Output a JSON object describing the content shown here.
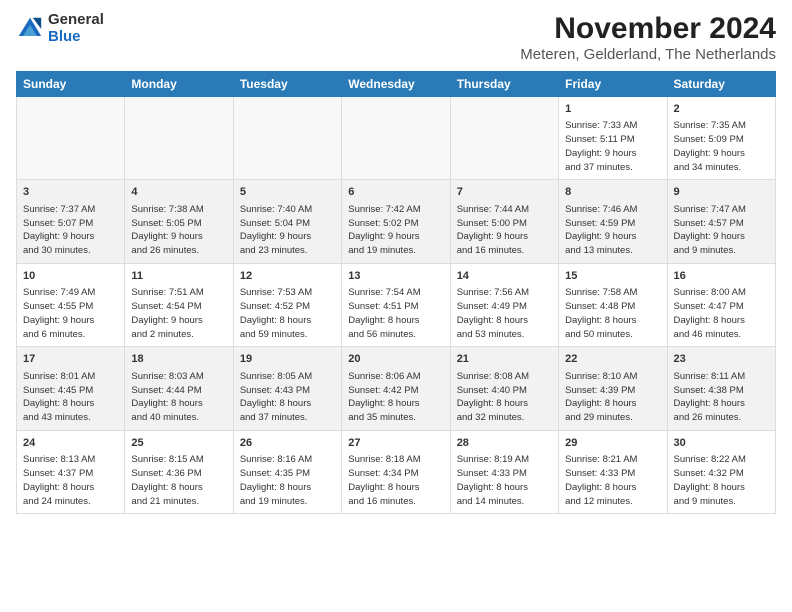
{
  "logo": {
    "general": "General",
    "blue": "Blue"
  },
  "title": "November 2024",
  "subtitle": "Meteren, Gelderland, The Netherlands",
  "weekdays": [
    "Sunday",
    "Monday",
    "Tuesday",
    "Wednesday",
    "Thursday",
    "Friday",
    "Saturday"
  ],
  "weeks": [
    [
      {
        "day": "",
        "info": ""
      },
      {
        "day": "",
        "info": ""
      },
      {
        "day": "",
        "info": ""
      },
      {
        "day": "",
        "info": ""
      },
      {
        "day": "",
        "info": ""
      },
      {
        "day": "1",
        "info": "Sunrise: 7:33 AM\nSunset: 5:11 PM\nDaylight: 9 hours\nand 37 minutes."
      },
      {
        "day": "2",
        "info": "Sunrise: 7:35 AM\nSunset: 5:09 PM\nDaylight: 9 hours\nand 34 minutes."
      }
    ],
    [
      {
        "day": "3",
        "info": "Sunrise: 7:37 AM\nSunset: 5:07 PM\nDaylight: 9 hours\nand 30 minutes."
      },
      {
        "day": "4",
        "info": "Sunrise: 7:38 AM\nSunset: 5:05 PM\nDaylight: 9 hours\nand 26 minutes."
      },
      {
        "day": "5",
        "info": "Sunrise: 7:40 AM\nSunset: 5:04 PM\nDaylight: 9 hours\nand 23 minutes."
      },
      {
        "day": "6",
        "info": "Sunrise: 7:42 AM\nSunset: 5:02 PM\nDaylight: 9 hours\nand 19 minutes."
      },
      {
        "day": "7",
        "info": "Sunrise: 7:44 AM\nSunset: 5:00 PM\nDaylight: 9 hours\nand 16 minutes."
      },
      {
        "day": "8",
        "info": "Sunrise: 7:46 AM\nSunset: 4:59 PM\nDaylight: 9 hours\nand 13 minutes."
      },
      {
        "day": "9",
        "info": "Sunrise: 7:47 AM\nSunset: 4:57 PM\nDaylight: 9 hours\nand 9 minutes."
      }
    ],
    [
      {
        "day": "10",
        "info": "Sunrise: 7:49 AM\nSunset: 4:55 PM\nDaylight: 9 hours\nand 6 minutes."
      },
      {
        "day": "11",
        "info": "Sunrise: 7:51 AM\nSunset: 4:54 PM\nDaylight: 9 hours\nand 2 minutes."
      },
      {
        "day": "12",
        "info": "Sunrise: 7:53 AM\nSunset: 4:52 PM\nDaylight: 8 hours\nand 59 minutes."
      },
      {
        "day": "13",
        "info": "Sunrise: 7:54 AM\nSunset: 4:51 PM\nDaylight: 8 hours\nand 56 minutes."
      },
      {
        "day": "14",
        "info": "Sunrise: 7:56 AM\nSunset: 4:49 PM\nDaylight: 8 hours\nand 53 minutes."
      },
      {
        "day": "15",
        "info": "Sunrise: 7:58 AM\nSunset: 4:48 PM\nDaylight: 8 hours\nand 50 minutes."
      },
      {
        "day": "16",
        "info": "Sunrise: 8:00 AM\nSunset: 4:47 PM\nDaylight: 8 hours\nand 46 minutes."
      }
    ],
    [
      {
        "day": "17",
        "info": "Sunrise: 8:01 AM\nSunset: 4:45 PM\nDaylight: 8 hours\nand 43 minutes."
      },
      {
        "day": "18",
        "info": "Sunrise: 8:03 AM\nSunset: 4:44 PM\nDaylight: 8 hours\nand 40 minutes."
      },
      {
        "day": "19",
        "info": "Sunrise: 8:05 AM\nSunset: 4:43 PM\nDaylight: 8 hours\nand 37 minutes."
      },
      {
        "day": "20",
        "info": "Sunrise: 8:06 AM\nSunset: 4:42 PM\nDaylight: 8 hours\nand 35 minutes."
      },
      {
        "day": "21",
        "info": "Sunrise: 8:08 AM\nSunset: 4:40 PM\nDaylight: 8 hours\nand 32 minutes."
      },
      {
        "day": "22",
        "info": "Sunrise: 8:10 AM\nSunset: 4:39 PM\nDaylight: 8 hours\nand 29 minutes."
      },
      {
        "day": "23",
        "info": "Sunrise: 8:11 AM\nSunset: 4:38 PM\nDaylight: 8 hours\nand 26 minutes."
      }
    ],
    [
      {
        "day": "24",
        "info": "Sunrise: 8:13 AM\nSunset: 4:37 PM\nDaylight: 8 hours\nand 24 minutes."
      },
      {
        "day": "25",
        "info": "Sunrise: 8:15 AM\nSunset: 4:36 PM\nDaylight: 8 hours\nand 21 minutes."
      },
      {
        "day": "26",
        "info": "Sunrise: 8:16 AM\nSunset: 4:35 PM\nDaylight: 8 hours\nand 19 minutes."
      },
      {
        "day": "27",
        "info": "Sunrise: 8:18 AM\nSunset: 4:34 PM\nDaylight: 8 hours\nand 16 minutes."
      },
      {
        "day": "28",
        "info": "Sunrise: 8:19 AM\nSunset: 4:33 PM\nDaylight: 8 hours\nand 14 minutes."
      },
      {
        "day": "29",
        "info": "Sunrise: 8:21 AM\nSunset: 4:33 PM\nDaylight: 8 hours\nand 12 minutes."
      },
      {
        "day": "30",
        "info": "Sunrise: 8:22 AM\nSunset: 4:32 PM\nDaylight: 8 hours\nand 9 minutes."
      }
    ]
  ]
}
